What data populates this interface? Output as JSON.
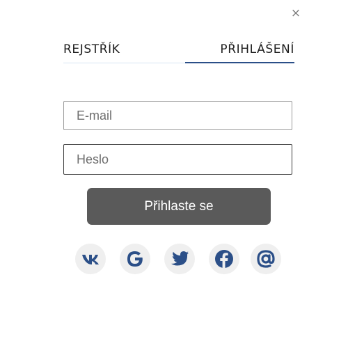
{
  "dialog": {
    "close_label": "×"
  },
  "tabs": [
    {
      "label": "REJSTŘÍK",
      "active": false
    },
    {
      "label": "PŘIHLÁŠENÍ",
      "active": true
    }
  ],
  "form": {
    "email_placeholder": "E-mail",
    "password_placeholder": "Heslo",
    "submit_label": "Přihlaste se"
  },
  "social": {
    "icons": [
      "vk-icon",
      "google-icon",
      "twitter-icon",
      "facebook-icon",
      "at-sign-icon"
    ],
    "icon_color": "#2b4f88",
    "bg_color": "#efefef"
  },
  "colors": {
    "accent": "#2b4f88",
    "button_bg": "#5a5a5a"
  }
}
